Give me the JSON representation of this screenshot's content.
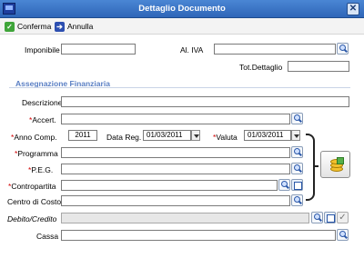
{
  "window": {
    "title": "Dettaglio Documento",
    "close_label": "✕"
  },
  "toolbar": {
    "confirm_label": "Conferma",
    "cancel_label": "Annulla"
  },
  "top": {
    "imponibile_label": "Imponibile",
    "imponibile_value": "",
    "aliva_label": "Al. IVA",
    "aliva_value": "",
    "tot_label": "Tot.Dettaglio",
    "tot_value": ""
  },
  "section_title": "Assegnazione Finanziaria",
  "form": {
    "descrizione_label": "Descrizione",
    "descrizione_value": "",
    "accert_label": "Accert.",
    "accert_value": "",
    "anno_label": "Anno Comp.",
    "anno_value": "2011",
    "datareg_label": "Data Reg.",
    "datareg_value": "01/03/2011",
    "valuta_label": "Valuta",
    "valuta_value": "01/03/2011",
    "programma_label": "Programma",
    "programma_value": "",
    "peg_label": "P.E.G.",
    "peg_value": "",
    "contropartita_label": "Contropartita",
    "contropartita_value": "",
    "centro_label": "Centro di Costo",
    "centro_value": "",
    "debito_label": "Debito/Credito",
    "debito_value": "",
    "cassa_label": "Cassa",
    "cassa_value": ""
  },
  "required_marker": "*",
  "colors": {
    "titlebar": "#2f66b8",
    "section": "#5a7fc4",
    "required": "#d00000"
  }
}
